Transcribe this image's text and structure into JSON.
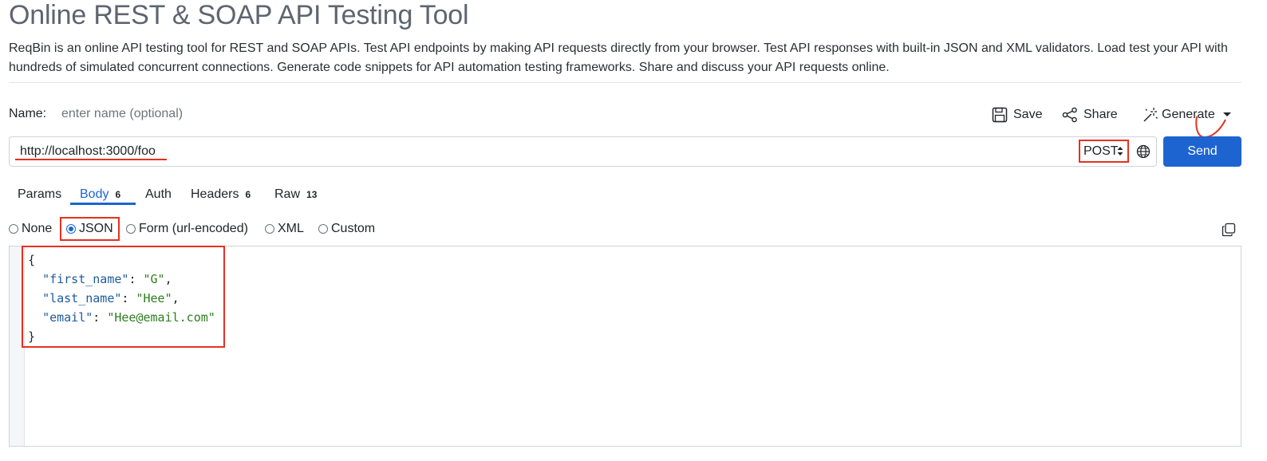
{
  "page": {
    "title": "Online REST & SOAP API Testing Tool",
    "description": "ReqBin is an online API testing tool for REST and SOAP APIs. Test API endpoints by making API requests directly from your browser. Test API responses with built-in JSON and XML validators. Load test your API with hundreds of simulated concurrent connections. Generate code snippets for API automation testing frameworks. Share and discuss your API requests online."
  },
  "request": {
    "name_label": "Name:",
    "name_placeholder": "enter name (optional)",
    "url": "http://localhost:3000/foo",
    "method": "POST",
    "send_label": "Send"
  },
  "toolbar": {
    "save_label": "Save",
    "share_label": "Share",
    "generate_label": "Generate"
  },
  "tabs": [
    {
      "label": "Params",
      "badge": ""
    },
    {
      "label": "Body",
      "badge": "6"
    },
    {
      "label": "Auth",
      "badge": ""
    },
    {
      "label": "Headers",
      "badge": "6"
    },
    {
      "label": "Raw",
      "badge": "13"
    }
  ],
  "body_types": [
    {
      "label": "None",
      "checked": false
    },
    {
      "label": "JSON",
      "checked": true
    },
    {
      "label": "Form (url-encoded)",
      "checked": false
    },
    {
      "label": "XML",
      "checked": false
    },
    {
      "label": "Custom",
      "checked": false
    }
  ],
  "editor": {
    "lines": [
      {
        "open": "{"
      },
      {
        "key": "\"first_name\"",
        "value": "\"G\"",
        "comma": ","
      },
      {
        "key": "\"last_name\"",
        "value": "\"Hee\"",
        "comma": ","
      },
      {
        "key": "\"email\"",
        "value": "\"Hee@email.com\"",
        "comma": ""
      },
      {
        "close": "}"
      }
    ]
  },
  "colors": {
    "accent": "#1d64d0",
    "annotation_red": "#e5311f",
    "json_key": "#1d5a9c",
    "json_string": "#2e7d1f"
  },
  "icons": {
    "save": "floppy-disk-icon",
    "share": "share-nodes-icon",
    "generate": "magic-wand-icon",
    "dropdown": "caret-down-icon",
    "globe": "globe-icon",
    "copy": "copy-icon"
  }
}
